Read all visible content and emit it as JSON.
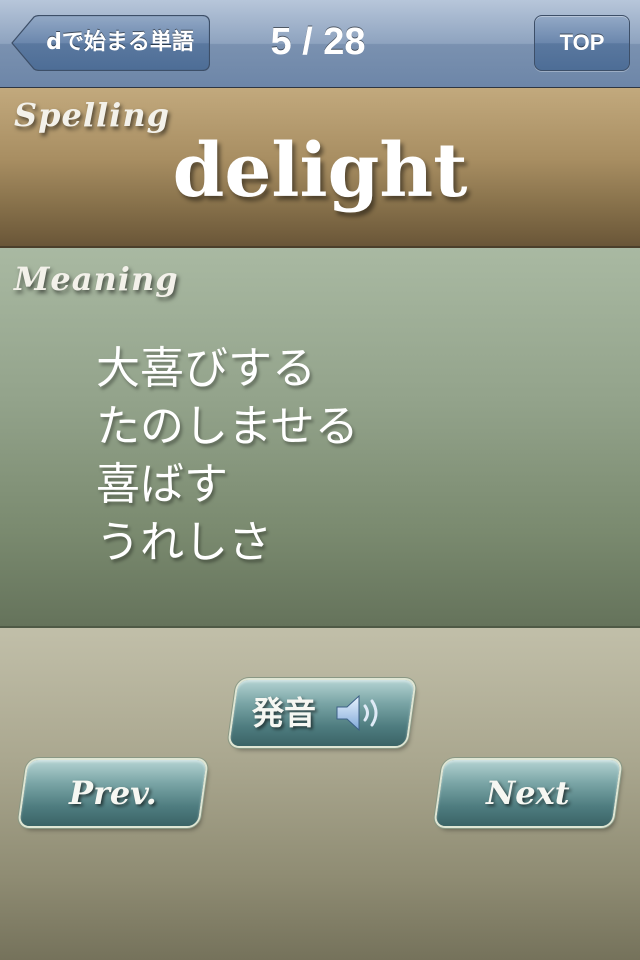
{
  "navbar": {
    "back_label": "dで始まる単語",
    "title": "5 / 28",
    "top_label": "TOP"
  },
  "spelling": {
    "section_label": "Spelling",
    "word": "delight"
  },
  "meaning": {
    "section_label": "Meaning",
    "lines": [
      "大喜びする",
      "たのしませる",
      "喜ばす",
      "うれしさ"
    ]
  },
  "controls": {
    "pronounce_label": "発音",
    "pronounce_icon": "speaker-icon",
    "prev_label": "Prev.",
    "next_label": "Next"
  },
  "colors": {
    "navbar": "#8ea3bf",
    "spelling_panel": "#a88e62",
    "meaning_panel": "#93a38b",
    "button_teal": "#4f7d80"
  }
}
